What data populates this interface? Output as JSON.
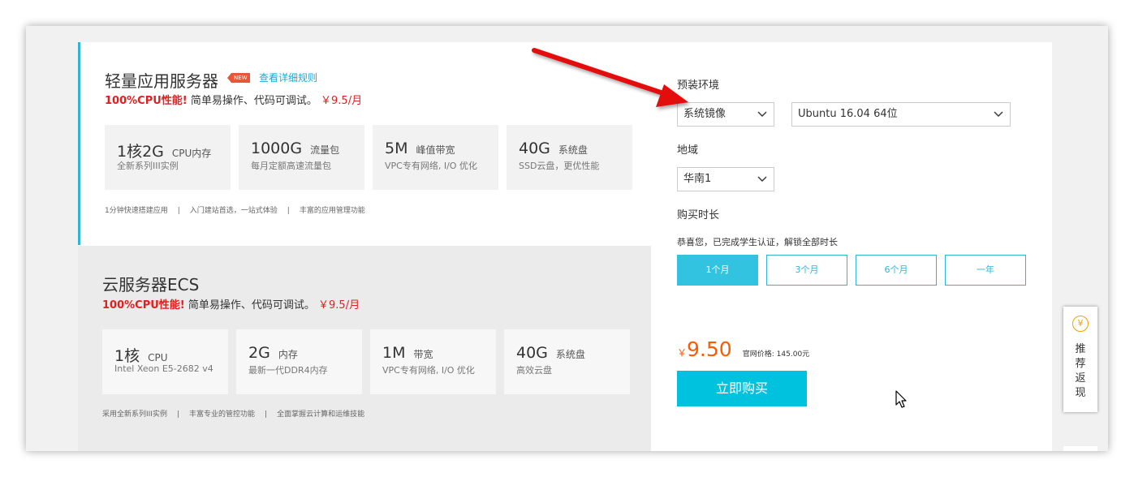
{
  "lightweight": {
    "title": "轻量应用服务器",
    "badge": "NEW",
    "details_link": "查看详细规则",
    "tagline_red": "100%CPU性能!",
    "tagline_text": "简单易操作、代码可调试。",
    "tagline_price": "￥9.5/月",
    "specs": [
      {
        "value": "1核2G",
        "unit": "CPU内存",
        "desc": "全新系列III实例"
      },
      {
        "value": "1000G",
        "unit": "流量包",
        "desc": "每月定额高速流量包"
      },
      {
        "value": "5M",
        "unit": "峰值带宽",
        "desc": "VPC专有网络, I/O 优化"
      },
      {
        "value": "40G",
        "unit": "系统盘",
        "desc": "SSD云盘，更优性能"
      }
    ],
    "features": [
      "1分钟快速搭建应用",
      "入门建站首选，一站式体验",
      "丰富的应用管理功能"
    ]
  },
  "ecs": {
    "title": "云服务器ECS",
    "tagline_red": "100%CPU性能!",
    "tagline_text": "简单易操作、代码可调试。",
    "tagline_price": "￥9.5/月",
    "specs": [
      {
        "value": "1核",
        "unit": "CPU",
        "desc": "Intel Xeon E5-2682 v4"
      },
      {
        "value": "2G",
        "unit": "内存",
        "desc": "最新一代DDR4内存"
      },
      {
        "value": "1M",
        "unit": "带宽",
        "desc": "VPC专有网络, I/O 优化"
      },
      {
        "value": "40G",
        "unit": "系统盘",
        "desc": "高效云盘"
      }
    ],
    "features": [
      "采用全新系列III实例",
      "丰富专业的管控功能",
      "全面掌握云计算和运维技能"
    ]
  },
  "config": {
    "env_label": "预装环境",
    "env_type": "系统镜像",
    "os": "Ubuntu 16.04 64位",
    "region_label": "地域",
    "region": "华南1",
    "duration_label": "购买时长",
    "student_note": "恭喜您，已完成学生认证，解锁全部时长",
    "durations": [
      "1个月",
      "3个月",
      "6个月",
      "一年"
    ],
    "selected_duration": "1个月",
    "currency": "￥",
    "price": "9.50",
    "official_price": "官网价格: 145.00元",
    "buy_label": "立即购买"
  },
  "side_widget": {
    "coin": "¥",
    "label": "推荐返现"
  },
  "colors": {
    "accent": "#00c1de",
    "price_red": "#e0201e",
    "arrow_red": "#e41010",
    "badge": "#e8553a"
  }
}
